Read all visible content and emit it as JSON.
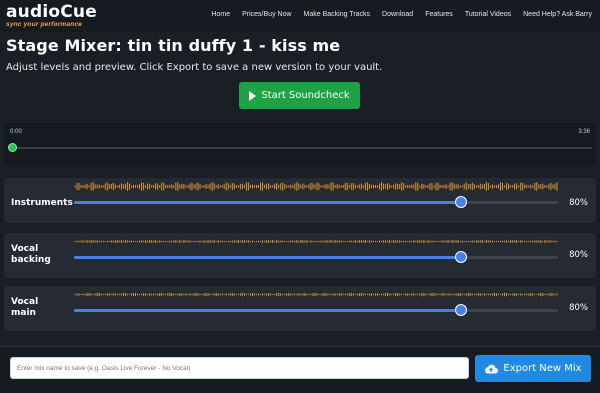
{
  "header": {
    "logo_text": "audioCue",
    "logo_tagline": "sync your performance",
    "nav": [
      "Home",
      "Prices/Buy Now",
      "Make Backing Tracks",
      "Download",
      "Features",
      "Tutorial Videos",
      "Need Help? Ask Barry"
    ]
  },
  "page": {
    "title": "Stage Mixer: tin tin duffy 1 - kiss me",
    "subtitle": "Adjust levels and preview. Click Export to save a new version to your vault.",
    "start_button": "Start Soundcheck"
  },
  "timeline": {
    "current_time": "0:00",
    "total_time": "3:36",
    "position": 0
  },
  "tracks": [
    {
      "label": "Instruments",
      "value_text": "80%",
      "value": 0.8
    },
    {
      "label": "Vocal backing",
      "value_text": "80%",
      "value": 0.8
    },
    {
      "label": "Vocal main",
      "value_text": "80%",
      "value": 0.8
    }
  ],
  "export": {
    "input_placeholder": "Enter mix name to save (e.g. Oasis Live Forever - No Vocal)",
    "input_value": "",
    "button_label": "Export New Mix"
  },
  "colors": {
    "accent_green": "#1fa244",
    "accent_blue": "#1f8ae6",
    "slider_blue": "#4a80e6",
    "wave_orange": "#d99a2b"
  }
}
